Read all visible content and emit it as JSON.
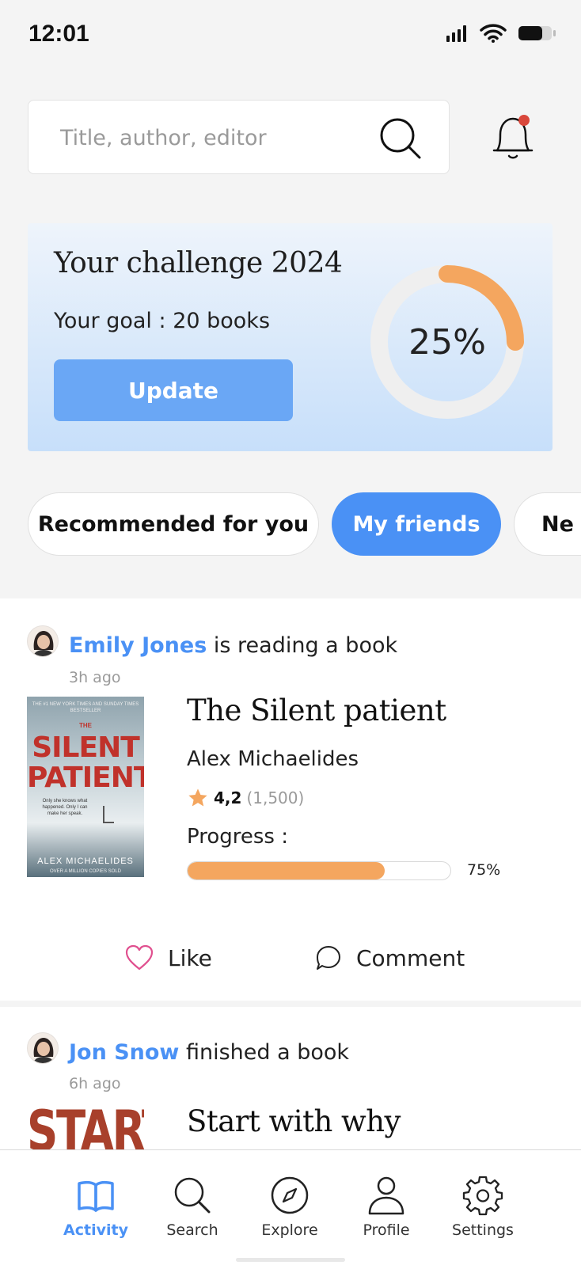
{
  "status_bar": {
    "time": "12:01"
  },
  "search": {
    "placeholder": "Title, author, editor"
  },
  "challenge": {
    "title": "Your challenge 2024",
    "goal": "Your goal : 20 books",
    "update_label": "Update",
    "percent_label": "25%",
    "progress_fraction": 0.25,
    "ring_color": "#f4a65f"
  },
  "chips": [
    {
      "label": "Recommended for you",
      "active": false
    },
    {
      "label": "My friends",
      "active": true
    },
    {
      "label": "Ne",
      "active": false
    }
  ],
  "feed": [
    {
      "user": "Emily Jones",
      "action": "is reading a book",
      "time": "3h ago",
      "book": {
        "title": "The Silent patient",
        "author": "Alex Michaelides",
        "rating": "4,2",
        "rating_count": "(1,500)",
        "progress_label": "Progress :",
        "progress_value": "75%",
        "progress_fraction": 0.75,
        "cover": {
          "top_line": "THE #1 NEW YORK TIMES AND SUNDAY TIMES BESTSELLER",
          "the": "THE",
          "title_line1": "SILENT",
          "title_line2": "PATIENT",
          "quote": "Only she knows what happened. Only I can make her speak.",
          "author": "ALEX MICHAELIDES",
          "bottom_line": "OVER A MILLION COPIES SOLD"
        }
      },
      "like_label": "Like",
      "comment_label": "Comment"
    },
    {
      "user": "Jon Snow",
      "action": "finished a book",
      "time": "6h ago",
      "book": {
        "title": "Start with why",
        "cover_text": "START"
      }
    }
  ],
  "nav": {
    "items": [
      {
        "label": "Activity",
        "icon": "book-icon",
        "active": true
      },
      {
        "label": "Search",
        "icon": "search-icon",
        "active": false
      },
      {
        "label": "Explore",
        "icon": "compass-icon",
        "active": false
      },
      {
        "label": "Profile",
        "icon": "user-icon",
        "active": false
      },
      {
        "label": "Settings",
        "icon": "gear-icon",
        "active": false
      }
    ]
  },
  "colors": {
    "accent": "#4a91f5",
    "progress": "#f4a65f",
    "notification_dot": "#d9473b",
    "like": "#e0508f"
  }
}
